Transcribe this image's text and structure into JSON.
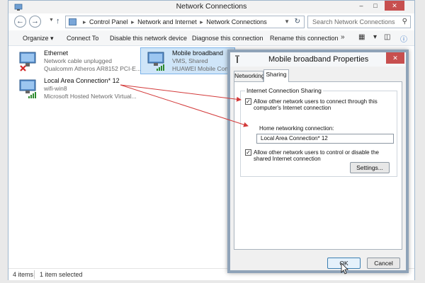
{
  "window": {
    "title": "Network Connections",
    "controls": [
      "–",
      "□",
      "✕"
    ]
  },
  "address_bar": {
    "crumbs": [
      "Control Panel",
      "Network and Internet",
      "Network Connections"
    ],
    "search_placeholder": "Search Network Connections"
  },
  "toolbar": {
    "items": [
      "Organize ▾",
      "Connect To",
      "Disable this network device",
      "Diagnose this connection",
      "Rename this connection",
      "»"
    ]
  },
  "connections": [
    {
      "name": "Ethernet",
      "status": "Network cable unplugged",
      "device": "Qualcomm Atheros AR8152 PCI-E..."
    },
    {
      "name": "Mobile broadband",
      "status": "VMS, Shared",
      "device": "HUAWEI Mobile Connect"
    },
    {
      "name": "Local Area Connection* 12",
      "status": "wifi-win8",
      "device": "Microsoft Hosted Network Virtual..."
    }
  ],
  "status_bar": {
    "items": "4 items",
    "selected": "1 item selected"
  },
  "dialog": {
    "title": "Mobile broadband Properties",
    "tabs": [
      "Networking",
      "Sharing"
    ],
    "active_tab": "Sharing",
    "group_label": "Internet Connection Sharing",
    "allow_connect": "Allow other network users to connect through this computer's Internet connection",
    "home_label": "Home networking connection:",
    "home_value": "Local Area Connection* 12",
    "allow_control": "Allow other network users to control or disable the shared Internet connection",
    "settings_btn": "Settings...",
    "ok_btn": "OK",
    "cancel_btn": "Cancel",
    "close": "✕"
  },
  "colors": {
    "annotation_arrow": "#d33a3a",
    "selection": "#cfe5f8",
    "close_button": "#c74f4f"
  }
}
